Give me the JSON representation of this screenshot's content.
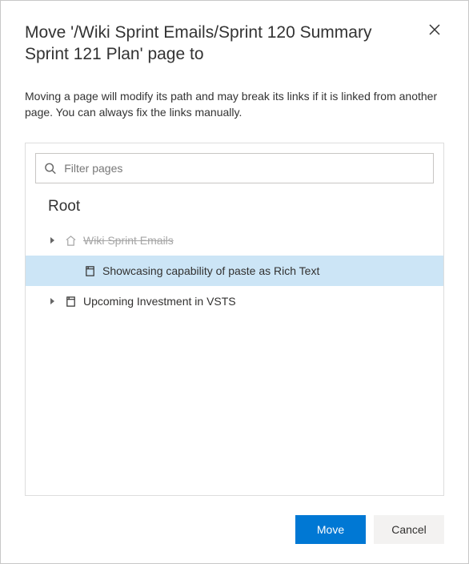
{
  "dialog": {
    "title": "Move '/Wiki Sprint Emails/Sprint 120 Summary Sprint 121 Plan' page to",
    "description": "Moving a page will modify its path and may break its links if it is linked from another page. You can always fix the links manually.",
    "filter_placeholder": "Filter pages",
    "root_label": "Root",
    "tree": [
      {
        "label": "Wiki Sprint Emails",
        "icon": "home",
        "depth": 0,
        "expandable": true,
        "disabled": true,
        "selected": false
      },
      {
        "label": "Showcasing capability of paste as Rich Text",
        "icon": "page",
        "depth": 1,
        "expandable": false,
        "disabled": false,
        "selected": true
      },
      {
        "label": "Upcoming Investment in VSTS",
        "icon": "page",
        "depth": 0,
        "expandable": true,
        "disabled": false,
        "selected": false
      }
    ],
    "buttons": {
      "move": "Move",
      "cancel": "Cancel"
    }
  }
}
